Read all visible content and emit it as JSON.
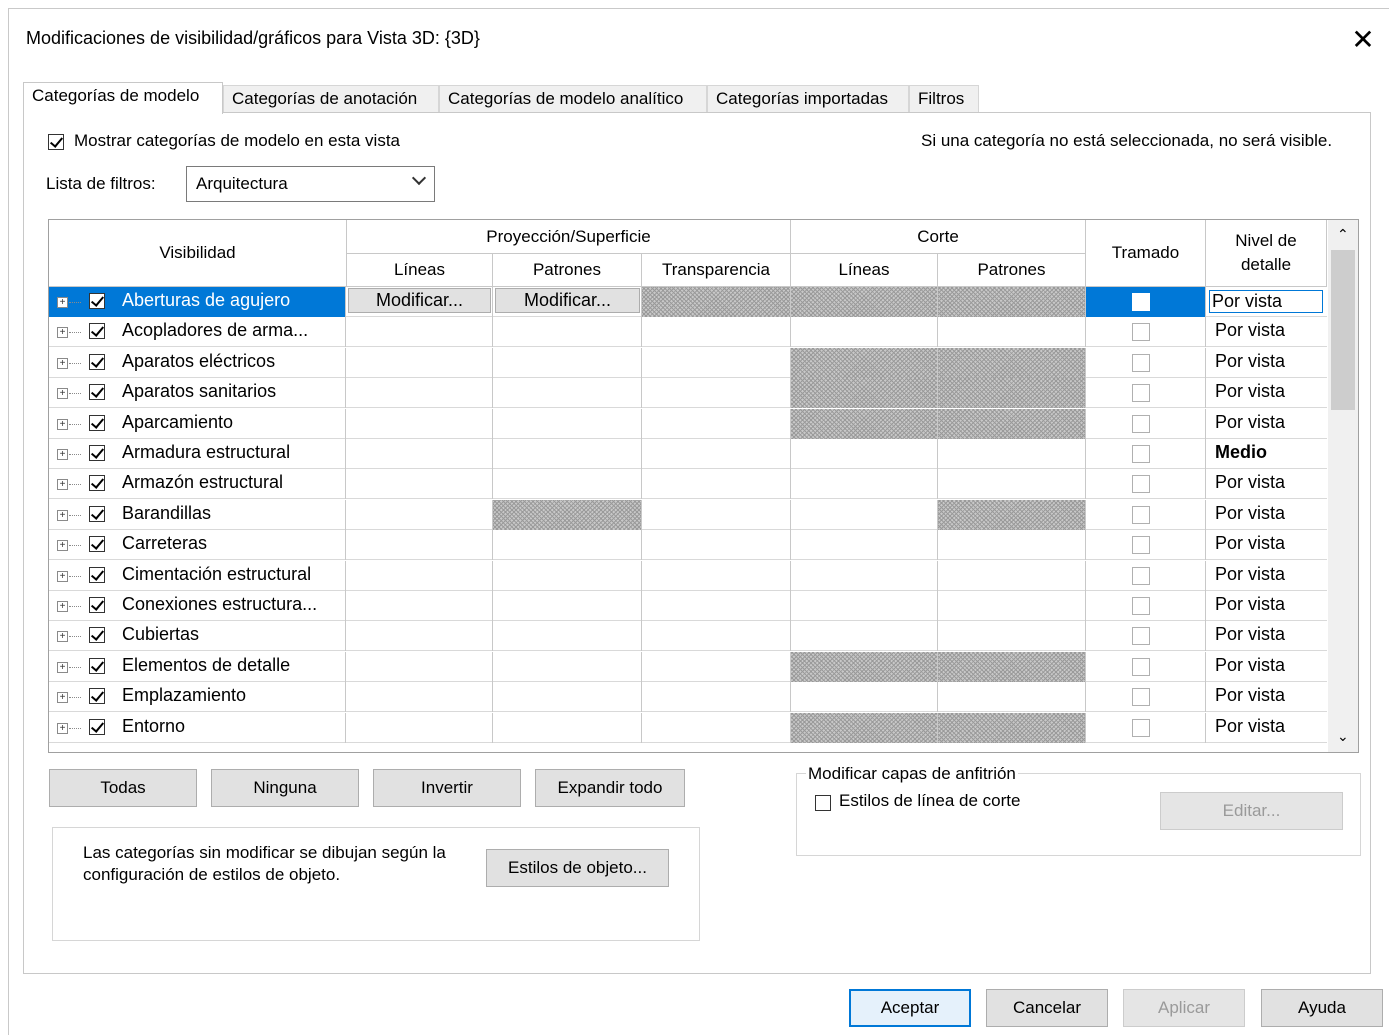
{
  "window": {
    "title": "Modificaciones de visibilidad/gráficos para Vista 3D: {3D}",
    "close_glyph": "✕"
  },
  "tabs": [
    {
      "label": "Categorías de modelo",
      "active": true
    },
    {
      "label": "Categorías de anotación",
      "active": false
    },
    {
      "label": "Categorías de modelo analítico",
      "active": false
    },
    {
      "label": "Categorías importadas",
      "active": false
    },
    {
      "label": "Filtros",
      "active": false
    }
  ],
  "show_categories": {
    "label": "Mostrar categorías de modelo en esta vista",
    "checked": true
  },
  "hint": "Si una categoría no está seleccionada, no será visible.",
  "filter": {
    "label": "Lista de filtros:",
    "value": "Arquitectura"
  },
  "grid": {
    "headers": {
      "visibility": "Visibilidad",
      "projection": "Proyección/Superficie",
      "proj_lines": "Líneas",
      "proj_patterns": "Patrones",
      "transparency": "Transparencia",
      "cut": "Corte",
      "cut_lines": "Líneas",
      "cut_patterns": "Patrones",
      "halftone": "Tramado",
      "detail_level": "Nivel de detalle"
    },
    "rows": [
      {
        "name": "Aberturas de agujero",
        "detail": "Por vista",
        "selected": true
      },
      {
        "name": "Acopladores de arma...",
        "detail": "Por vista"
      },
      {
        "name": "Aparatos eléctricos",
        "detail": "Por vista"
      },
      {
        "name": "Aparatos sanitarios",
        "detail": "Por vista"
      },
      {
        "name": "Aparcamiento",
        "detail": "Por vista"
      },
      {
        "name": "Armadura estructural",
        "detail": "Medio"
      },
      {
        "name": "Armazón estructural",
        "detail": "Por vista"
      },
      {
        "name": "Barandillas",
        "detail": "Por vista"
      },
      {
        "name": "Carreteras",
        "detail": "Por vista"
      },
      {
        "name": "Cimentación estructural",
        "detail": "Por vista"
      },
      {
        "name": "Conexiones estructura...",
        "detail": "Por vista"
      },
      {
        "name": "Cubiertas",
        "detail": "Por vista"
      },
      {
        "name": "Elementos de detalle",
        "detail": "Por vista"
      },
      {
        "name": "Emplazamiento",
        "detail": "Por vista"
      },
      {
        "name": "Entorno",
        "detail": "Por vista"
      }
    ],
    "override_label": "Modificar..."
  },
  "buttons": {
    "all": "Todas",
    "none": "Ninguna",
    "invert": "Invertir",
    "expand": "Expandir todo",
    "object_styles": "Estilos de objeto...",
    "edit": "Editar...",
    "ok": "Aceptar",
    "cancel": "Cancelar",
    "apply": "Aplicar",
    "help": "Ayuda"
  },
  "note": {
    "line1": "Las categorías sin modificar se dibujan según la",
    "line2": "configuración de estilos de objeto."
  },
  "host_layers": {
    "title": "Modificar capas de anfitrión",
    "cut_styles": "Estilos de línea de corte",
    "checked": false
  }
}
